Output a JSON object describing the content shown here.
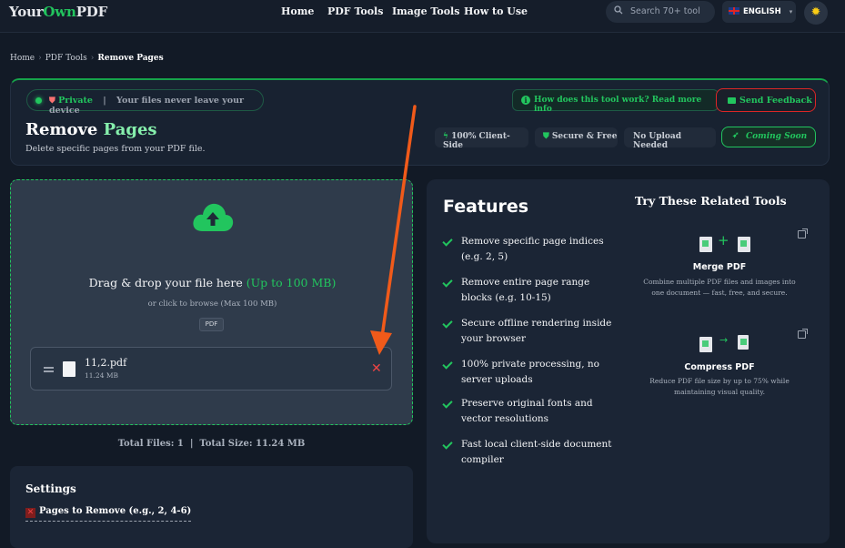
{
  "header": {
    "logo_a": "Your",
    "logo_b": "Own",
    "logo_c": "PDF",
    "nav": [
      "Home",
      "PDF Tools",
      "Image Tools",
      "How to Use"
    ],
    "search_placeholder": "Search 70+ tool",
    "language": "ENGLISH",
    "theme_icon": "sun-icon"
  },
  "breadcrumb": {
    "items": [
      "Home",
      "PDF Tools"
    ],
    "current": "Remove Pages"
  },
  "banner": {
    "private_label": "Private",
    "private_sep": "|",
    "private_note": "Your files never leave your device",
    "title_a": "Remove ",
    "title_b": "Pages",
    "subtitle": "Delete specific pages from your PDF file.",
    "howto": "How does this tool work? Read more info",
    "feedback": "Send Feedback",
    "chips": [
      "100% Client-Side",
      "Secure & Free",
      "No Upload Needed"
    ],
    "coming_soon": "Coming Soon"
  },
  "dropzone": {
    "main_text": "Drag & drop your file here ",
    "limit": "(Up to 100 MB)",
    "browse": "or click to browse (Max 100 MB)",
    "badge": "PDF"
  },
  "file": {
    "name": "11,2.pdf",
    "size": "11.24 MB"
  },
  "totals": "Total Files: 1  |  Total Size: 11.24 MB",
  "settings": {
    "title": "Settings",
    "field_label": "Pages to Remove (e.g., 2, 4-6)"
  },
  "features": {
    "title": "Features",
    "items": [
      "Remove specific page indices (e.g. 2, 5)",
      "Remove entire page range blocks (e.g. 10-15)",
      "Secure offline rendering inside your browser",
      "100% private processing, no server uploads",
      "Preserve original fonts and vector resolutions",
      "Fast local client-side document compiler"
    ]
  },
  "related": {
    "title": "Try These Related Tools",
    "tools": [
      {
        "name": "Merge PDF",
        "desc": "Combine multiple PDF files and images into one document — fast, free, and secure."
      },
      {
        "name": "Compress PDF",
        "desc": "Reduce PDF file size by up to 75% while maintaining visual quality."
      }
    ]
  },
  "colors": {
    "accent": "#22c55e",
    "background": "#121a26",
    "danger": "#ef4444",
    "annotation_arrow": "#f05a1a"
  }
}
